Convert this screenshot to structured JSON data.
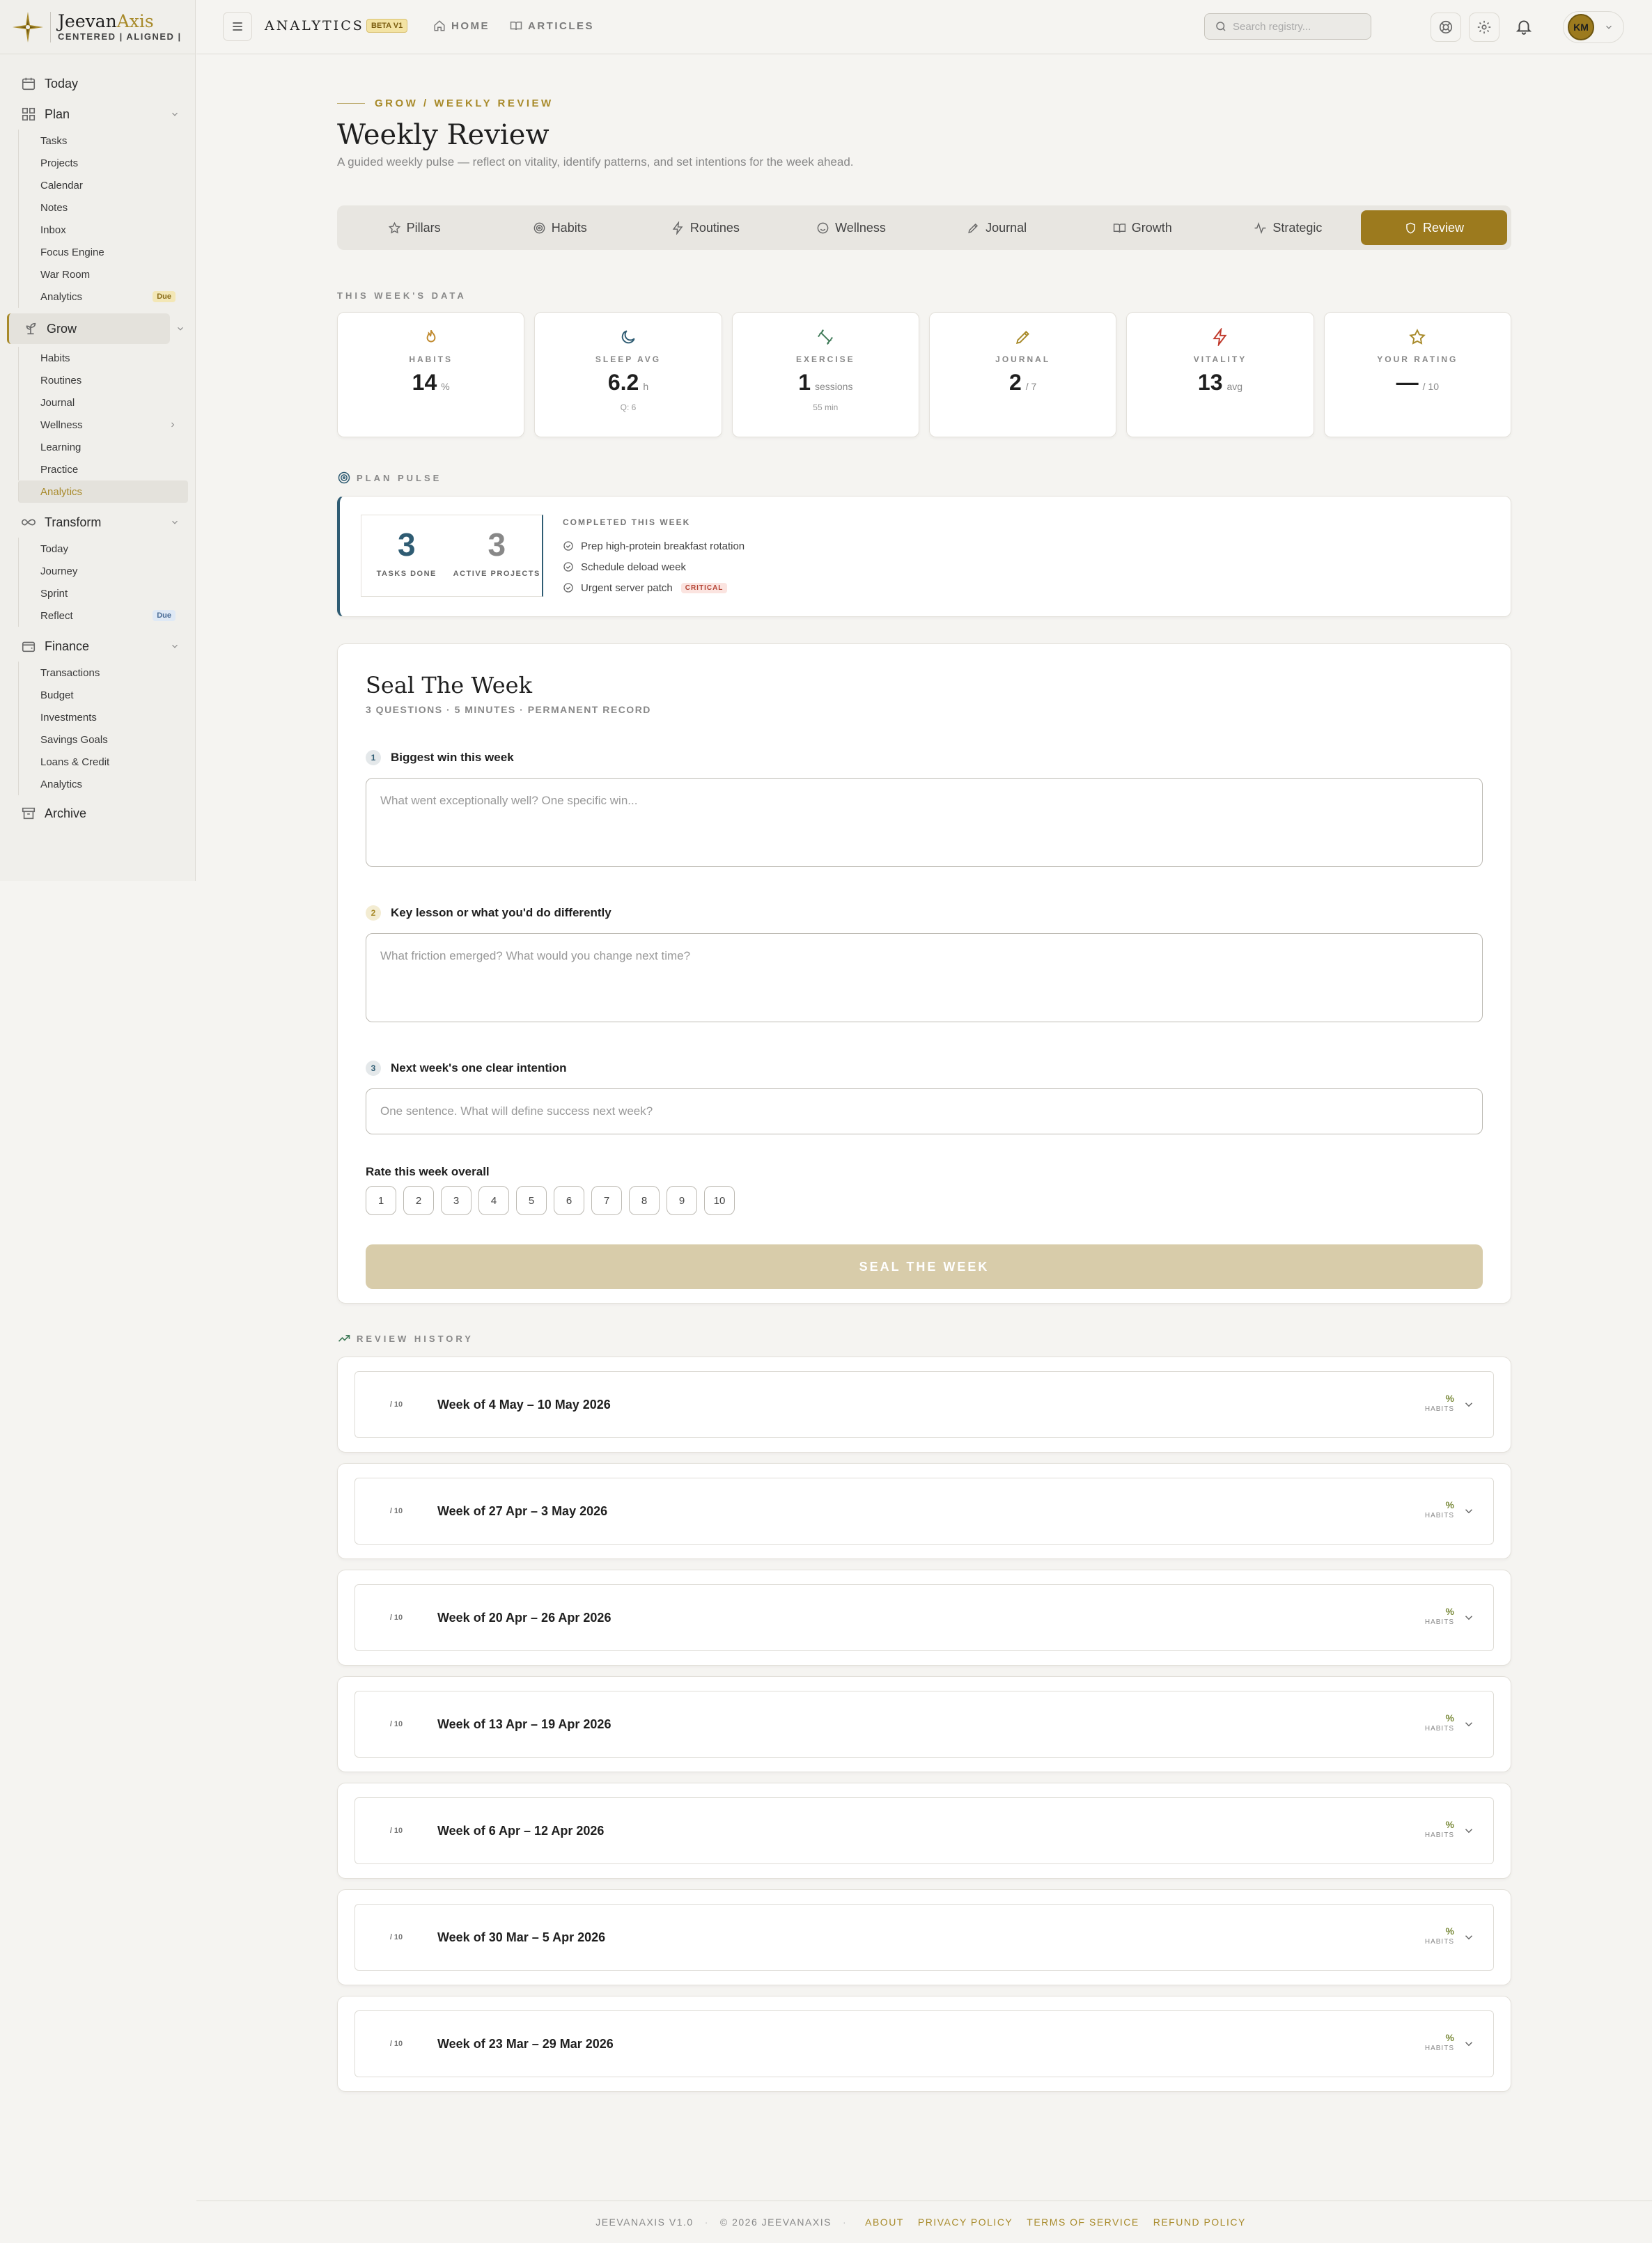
{
  "brand": {
    "name_a": "Jeevan",
    "name_b": "Axis",
    "tagline": "CENTERED | ALIGNED | INTENTIONAL"
  },
  "sidebar": {
    "today": "Today",
    "plan": {
      "label": "Plan",
      "items": [
        "Tasks",
        "Projects",
        "Calendar",
        "Notes",
        "Inbox",
        "Focus Engine",
        "War Room",
        "Analytics"
      ],
      "analytics_badge": "Due"
    },
    "grow": {
      "label": "Grow",
      "items": [
        "Habits",
        "Routines",
        "Journal",
        "Wellness",
        "Learning",
        "Practice",
        "Analytics"
      ]
    },
    "transform": {
      "label": "Transform",
      "items": [
        "Today",
        "Journey",
        "Sprint",
        "Reflect"
      ],
      "reflect_badge": "Due"
    },
    "finance": {
      "label": "Finance",
      "items": [
        "Transactions",
        "Budget",
        "Investments",
        "Savings Goals",
        "Loans & Credit",
        "Analytics"
      ]
    },
    "archive": "Archive"
  },
  "topbar": {
    "title": "ANALYTICS",
    "beta": "BETA V1",
    "home": "HOME",
    "articles": "ARTICLES",
    "search_placeholder": "Search registry...",
    "avatar": "KM"
  },
  "page": {
    "breadcrumb": "GROW / WEEKLY REVIEW",
    "title": "Weekly Review",
    "subtitle": "A guided weekly pulse — reflect on vitality, identify patterns, and set intentions for the week ahead."
  },
  "tabs": [
    "Pillars",
    "Habits",
    "Routines",
    "Wellness",
    "Journal",
    "Growth",
    "Strategic",
    "Review"
  ],
  "week_data": {
    "label": "THIS WEEK'S DATA",
    "stats": [
      {
        "label": "HABITS",
        "value": "14",
        "unit": "%",
        "note": "",
        "color": "#c08a2e",
        "icon": "flame-icon"
      },
      {
        "label": "SLEEP AVG",
        "value": "6.2",
        "unit": "h",
        "note": "Q: 6",
        "color": "#2f5c73",
        "icon": "moon-icon"
      },
      {
        "label": "EXERCISE",
        "value": "1",
        "unit": "sessions",
        "note": "55 min",
        "color": "#3f7a58",
        "icon": "dumbbell-icon"
      },
      {
        "label": "JOURNAL",
        "value": "2",
        "unit": "/ 7",
        "note": "",
        "color": "#a88a2a",
        "icon": "pen-icon"
      },
      {
        "label": "VITALITY",
        "value": "13",
        "unit": "avg",
        "note": "",
        "color": "#c0392b",
        "icon": "bolt-icon"
      },
      {
        "label": "YOUR RATING",
        "value": "—",
        "unit": "/ 10",
        "note": "",
        "color": "#a88a2a",
        "icon": "star-icon"
      }
    ]
  },
  "plan_pulse": {
    "label": "PLAN PULSE",
    "tasks_done": "3",
    "tasks_label": "TASKS DONE",
    "projects": "3",
    "projects_label": "ACTIVE PROJECTS",
    "completed_title": "COMPLETED THIS WEEK",
    "items": [
      "Prep high-protein breakfast rotation",
      "Schedule deload week",
      "Urgent server patch"
    ],
    "critical": "CRITICAL"
  },
  "seal": {
    "title": "Seal The Week",
    "meta": "3 QUESTIONS · 5 MINUTES · PERMANENT RECORD",
    "questions": [
      {
        "num": "1",
        "label": "Biggest win this week",
        "placeholder": "What went exceptionally well? One specific win..."
      },
      {
        "num": "2",
        "label": "Key lesson or what you'd do differently",
        "placeholder": "What friction emerged? What would you change next time?"
      },
      {
        "num": "3",
        "label": "Next week's one clear intention",
        "placeholder": "One sentence. What will define success next week?"
      }
    ],
    "rate_title": "Rate this week overall",
    "rates": [
      "1",
      "2",
      "3",
      "4",
      "5",
      "6",
      "7",
      "8",
      "9",
      "10"
    ],
    "button": "SEAL THE WEEK"
  },
  "history": {
    "label": "REVIEW HISTORY",
    "score_suffix": "/ 10",
    "pct": "%",
    "habits_label": "HABITS",
    "weeks": [
      "Week of 4 May – 10 May 2026",
      "Week of 27 Apr – 3 May 2026",
      "Week of 20 Apr – 26 Apr 2026",
      "Week of 13 Apr – 19 Apr 2026",
      "Week of 6 Apr – 12 Apr 2026",
      "Week of 30 Mar – 5 Apr 2026",
      "Week of 23 Mar – 29 Mar 2026"
    ]
  },
  "footer": {
    "version": "JEEVANAXIS V1.0",
    "copyright": "© 2026 JEEVANAXIS",
    "links": [
      "ABOUT",
      "PRIVACY POLICY",
      "TERMS OF SERVICE",
      "REFUND POLICY"
    ]
  }
}
